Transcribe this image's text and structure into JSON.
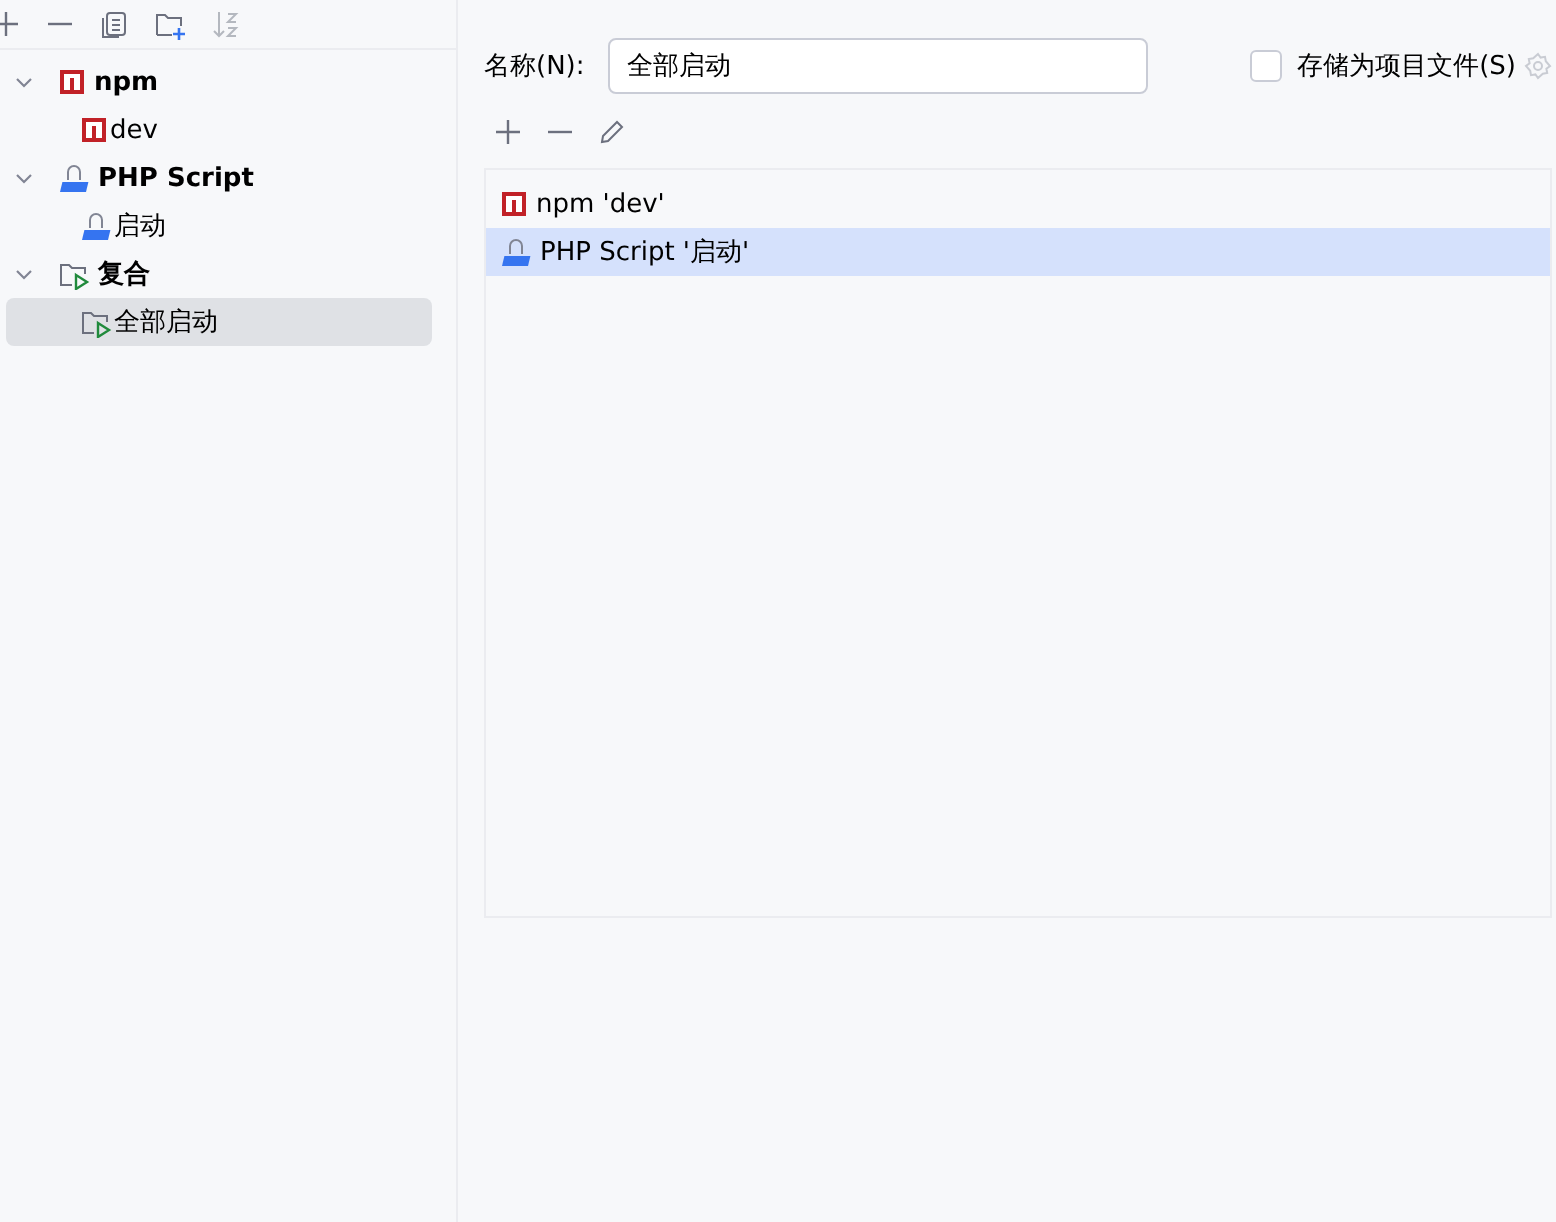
{
  "sidebar": {
    "tree": [
      {
        "label": "npm",
        "kind": "npm",
        "expanded": true,
        "selected": false,
        "children": [
          {
            "label": "dev",
            "kind": "npm",
            "selected": false
          }
        ]
      },
      {
        "label": "PHP Script",
        "kind": "php",
        "expanded": true,
        "selected": false,
        "children": [
          {
            "label": "启动",
            "kind": "php",
            "selected": false
          }
        ]
      },
      {
        "label": "复合",
        "kind": "compound",
        "expanded": true,
        "selected": false,
        "children": [
          {
            "label": "全部启动",
            "kind": "compound",
            "selected": true
          }
        ]
      }
    ]
  },
  "form": {
    "name_label": "名称(N):",
    "name_value": "全部启动",
    "store_label": "存储为项目文件(S)",
    "store_checked": false,
    "list": [
      {
        "label": "npm 'dev'",
        "kind": "npm",
        "selected": false
      },
      {
        "label": "PHP Script '启动'",
        "kind": "php",
        "selected": true
      }
    ]
  }
}
